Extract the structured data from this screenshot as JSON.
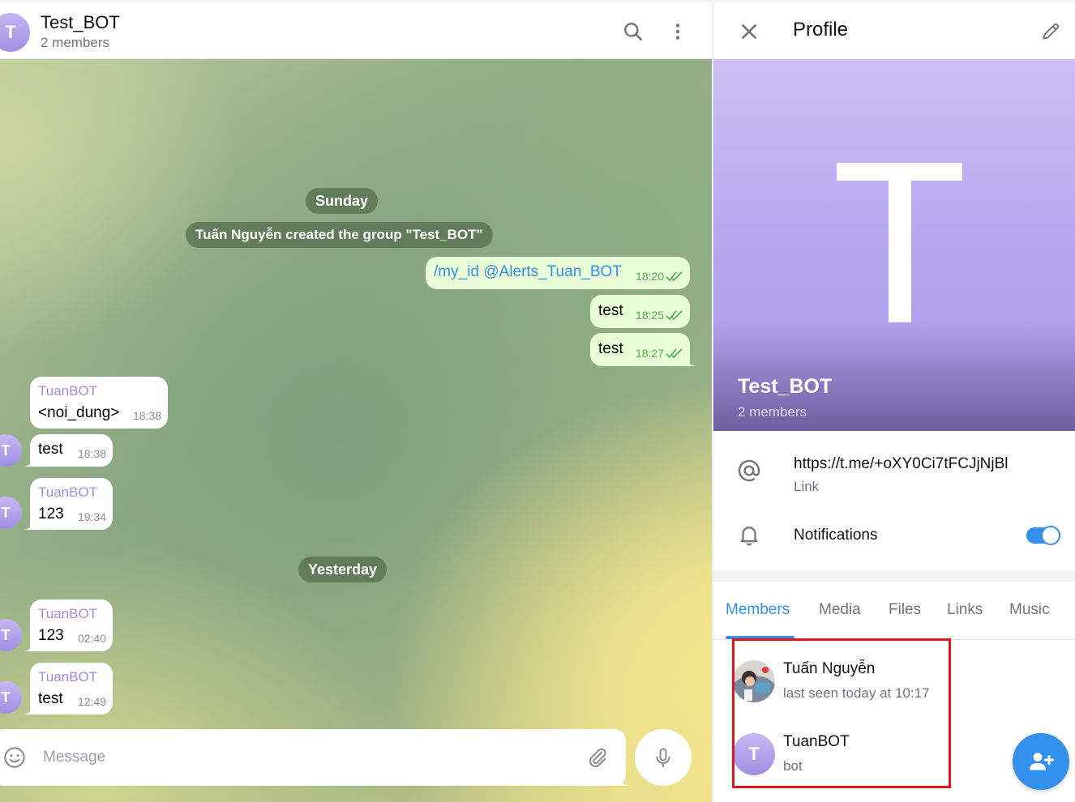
{
  "chat": {
    "avatar_letter": "T",
    "title": "Test_BOT",
    "subtitle": "2 members",
    "date_sunday": "Sunday",
    "service_created": "Tuấn Nguyễn created the group \"Test_BOT\"",
    "date_yesterday": "Yesterday",
    "messages": [
      {
        "text": "/my_id @Alerts_Tuan_BOT",
        "time": "18:20"
      },
      {
        "text": "test",
        "time": "18:25"
      },
      {
        "text": "test",
        "time": "18:27"
      },
      {
        "sender": "TuanBOT",
        "text": "<noi_dung>",
        "time": "18:38"
      },
      {
        "text": "test",
        "time": "18:38"
      },
      {
        "sender": "TuanBOT",
        "text": "123",
        "time": "19:34"
      },
      {
        "sender": "TuanBOT",
        "text": "123",
        "time": "02:40"
      },
      {
        "sender": "TuanBOT",
        "text": "test",
        "time": "12:49"
      }
    ],
    "composer_placeholder": "Message"
  },
  "profile": {
    "title": "Profile",
    "cover_letter": "T",
    "name": "Test_BOT",
    "members_count": "2 members",
    "link": "https://t.me/+oXY0Ci7tFCJjNjBl",
    "link_label": "Link",
    "notifications_label": "Notifications",
    "notifications_on": true,
    "tabs": [
      "Members",
      "Media",
      "Files",
      "Links",
      "Music"
    ],
    "active_tab": "Members",
    "members": [
      {
        "name": "Tuấn Nguyễn",
        "status": "last seen today at 10:17"
      },
      {
        "name": "TuanBOT",
        "status": "bot",
        "avatar_letter": "T"
      }
    ]
  },
  "colors": {
    "accent": "#3390ec",
    "outgoing_bubble": "#e9fdd6",
    "sender_name": "#a58be0",
    "highlight_box": "#e0141d"
  }
}
